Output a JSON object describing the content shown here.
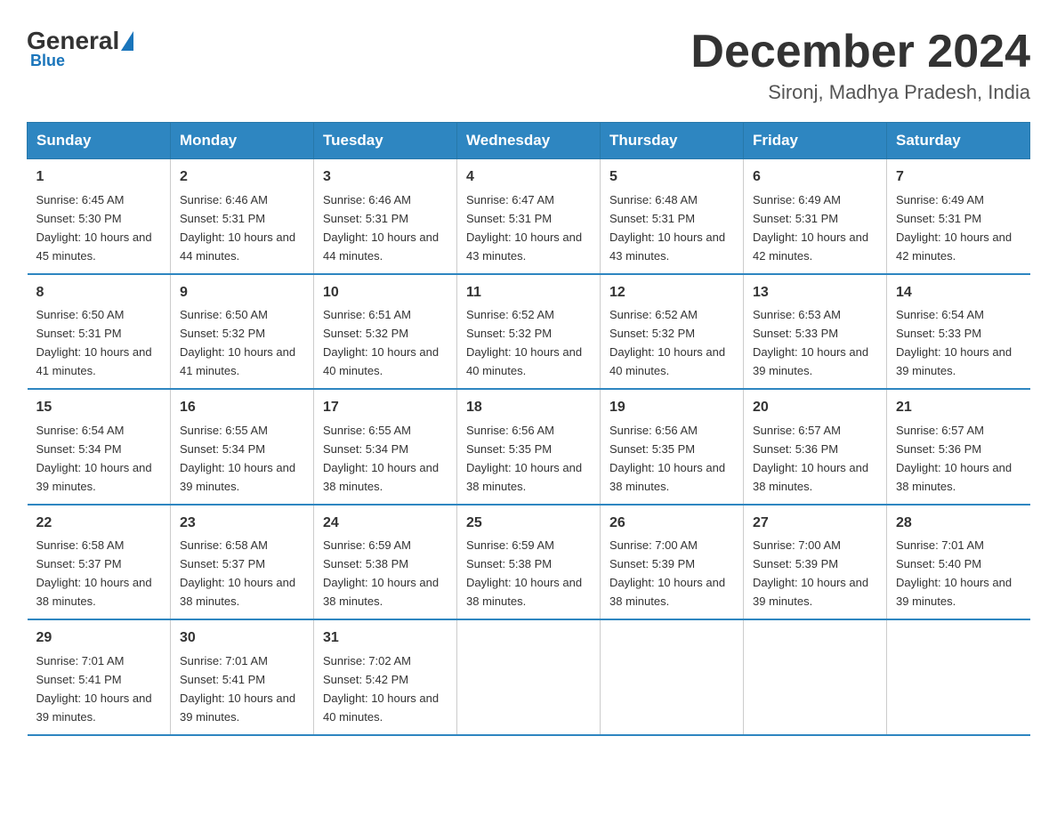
{
  "logo": {
    "general": "General",
    "blue": "Blue",
    "subtitle": "Blue"
  },
  "title": "December 2024",
  "subtitle": "Sironj, Madhya Pradesh, India",
  "days_of_week": [
    "Sunday",
    "Monday",
    "Tuesday",
    "Wednesday",
    "Thursday",
    "Friday",
    "Saturday"
  ],
  "weeks": [
    [
      {
        "day": "1",
        "sunrise": "6:45 AM",
        "sunset": "5:30 PM",
        "daylight": "10 hours and 45 minutes."
      },
      {
        "day": "2",
        "sunrise": "6:46 AM",
        "sunset": "5:31 PM",
        "daylight": "10 hours and 44 minutes."
      },
      {
        "day": "3",
        "sunrise": "6:46 AM",
        "sunset": "5:31 PM",
        "daylight": "10 hours and 44 minutes."
      },
      {
        "day": "4",
        "sunrise": "6:47 AM",
        "sunset": "5:31 PM",
        "daylight": "10 hours and 43 minutes."
      },
      {
        "day": "5",
        "sunrise": "6:48 AM",
        "sunset": "5:31 PM",
        "daylight": "10 hours and 43 minutes."
      },
      {
        "day": "6",
        "sunrise": "6:49 AM",
        "sunset": "5:31 PM",
        "daylight": "10 hours and 42 minutes."
      },
      {
        "day": "7",
        "sunrise": "6:49 AM",
        "sunset": "5:31 PM",
        "daylight": "10 hours and 42 minutes."
      }
    ],
    [
      {
        "day": "8",
        "sunrise": "6:50 AM",
        "sunset": "5:31 PM",
        "daylight": "10 hours and 41 minutes."
      },
      {
        "day": "9",
        "sunrise": "6:50 AM",
        "sunset": "5:32 PM",
        "daylight": "10 hours and 41 minutes."
      },
      {
        "day": "10",
        "sunrise": "6:51 AM",
        "sunset": "5:32 PM",
        "daylight": "10 hours and 40 minutes."
      },
      {
        "day": "11",
        "sunrise": "6:52 AM",
        "sunset": "5:32 PM",
        "daylight": "10 hours and 40 minutes."
      },
      {
        "day": "12",
        "sunrise": "6:52 AM",
        "sunset": "5:32 PM",
        "daylight": "10 hours and 40 minutes."
      },
      {
        "day": "13",
        "sunrise": "6:53 AM",
        "sunset": "5:33 PM",
        "daylight": "10 hours and 39 minutes."
      },
      {
        "day": "14",
        "sunrise": "6:54 AM",
        "sunset": "5:33 PM",
        "daylight": "10 hours and 39 minutes."
      }
    ],
    [
      {
        "day": "15",
        "sunrise": "6:54 AM",
        "sunset": "5:34 PM",
        "daylight": "10 hours and 39 minutes."
      },
      {
        "day": "16",
        "sunrise": "6:55 AM",
        "sunset": "5:34 PM",
        "daylight": "10 hours and 39 minutes."
      },
      {
        "day": "17",
        "sunrise": "6:55 AM",
        "sunset": "5:34 PM",
        "daylight": "10 hours and 38 minutes."
      },
      {
        "day": "18",
        "sunrise": "6:56 AM",
        "sunset": "5:35 PM",
        "daylight": "10 hours and 38 minutes."
      },
      {
        "day": "19",
        "sunrise": "6:56 AM",
        "sunset": "5:35 PM",
        "daylight": "10 hours and 38 minutes."
      },
      {
        "day": "20",
        "sunrise": "6:57 AM",
        "sunset": "5:36 PM",
        "daylight": "10 hours and 38 minutes."
      },
      {
        "day": "21",
        "sunrise": "6:57 AM",
        "sunset": "5:36 PM",
        "daylight": "10 hours and 38 minutes."
      }
    ],
    [
      {
        "day": "22",
        "sunrise": "6:58 AM",
        "sunset": "5:37 PM",
        "daylight": "10 hours and 38 minutes."
      },
      {
        "day": "23",
        "sunrise": "6:58 AM",
        "sunset": "5:37 PM",
        "daylight": "10 hours and 38 minutes."
      },
      {
        "day": "24",
        "sunrise": "6:59 AM",
        "sunset": "5:38 PM",
        "daylight": "10 hours and 38 minutes."
      },
      {
        "day": "25",
        "sunrise": "6:59 AM",
        "sunset": "5:38 PM",
        "daylight": "10 hours and 38 minutes."
      },
      {
        "day": "26",
        "sunrise": "7:00 AM",
        "sunset": "5:39 PM",
        "daylight": "10 hours and 38 minutes."
      },
      {
        "day": "27",
        "sunrise": "7:00 AM",
        "sunset": "5:39 PM",
        "daylight": "10 hours and 39 minutes."
      },
      {
        "day": "28",
        "sunrise": "7:01 AM",
        "sunset": "5:40 PM",
        "daylight": "10 hours and 39 minutes."
      }
    ],
    [
      {
        "day": "29",
        "sunrise": "7:01 AM",
        "sunset": "5:41 PM",
        "daylight": "10 hours and 39 minutes."
      },
      {
        "day": "30",
        "sunrise": "7:01 AM",
        "sunset": "5:41 PM",
        "daylight": "10 hours and 39 minutes."
      },
      {
        "day": "31",
        "sunrise": "7:02 AM",
        "sunset": "5:42 PM",
        "daylight": "10 hours and 40 minutes."
      },
      null,
      null,
      null,
      null
    ]
  ]
}
